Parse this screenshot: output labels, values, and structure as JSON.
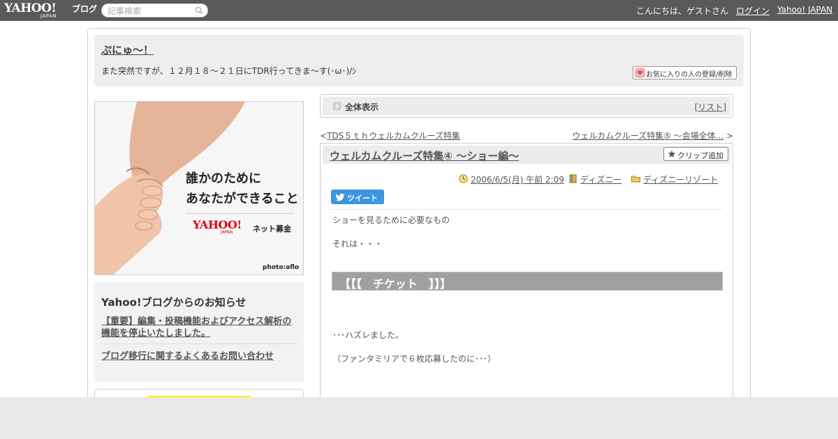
{
  "topbar": {
    "logo_main": "YAHOO!",
    "logo_sub": "JAPAN",
    "logo_blog": "ブログ",
    "search_placeholder": "記事検索",
    "greeting": "こんにちは、ゲストさん",
    "login": "ログイン",
    "yahoo_japan": "Yahoo! JAPAN"
  },
  "blog": {
    "title": "ぷにゅ～！",
    "description": "また突然ですが、１２月１８～２１日にTDR行ってきま～す(･ω･)/ｼ",
    "favorite_button": "お気に入りの人の登録/削除"
  },
  "ad": {
    "copy_line1": "誰かのために",
    "copy_line2": "あなたができること",
    "logo": "YAHOO!",
    "logo_sub": "JAPAN",
    "label": "ネット募金",
    "credit": "photo:aflo"
  },
  "notice": {
    "heading": "Yahoo!ブログからのお知らせ",
    "items": [
      "【重要】編集・投稿機能およびアクセス解析の機能を停止いたしました。",
      "ブログ移行に関するよくあるお問い合わせ"
    ]
  },
  "nav": {
    "all_view": "全体表示",
    "list_open": "[",
    "list_label": "リスト",
    "list_close": "]",
    "prev_marker": "<",
    "prev_title": "TDS５ｔｈウェルカムクルーズ特集",
    "next_title": "ウェルカムクルーズ特集⑤ ～会場全体...",
    "next_marker": ">"
  },
  "article": {
    "title": "ウェルカムクルーズ特集④ ～ショー編～",
    "clip_button": "クリップ追加",
    "date": "2006/6/5(月) 午前 2:09",
    "category": "ディズニー",
    "folder": "ディズニーリゾート",
    "tweet_label": "ツイート",
    "line1": "ショーを見るために必要なもの",
    "line2": "それは・・・",
    "heading": "【【【　チケット　】】】",
    "line3": "･･･ハズレました。",
    "line4": "（ファンタミリアで６枚応募したのに･･･）"
  },
  "colors": {
    "topbar": "#5a5a5a",
    "tweet": "#3d95e0",
    "ticket_bar": "#9fa0a0",
    "header_bg": "#eeeeee"
  },
  "icons": {
    "search": "magnifier-icon",
    "favorite": "heart-user-icon",
    "all_view": "arrow-box-icon",
    "clip": "star-icon",
    "date": "clock-icon",
    "category": "book-icon",
    "folder": "folder-icon",
    "tweet": "twitter-bird-icon"
  }
}
